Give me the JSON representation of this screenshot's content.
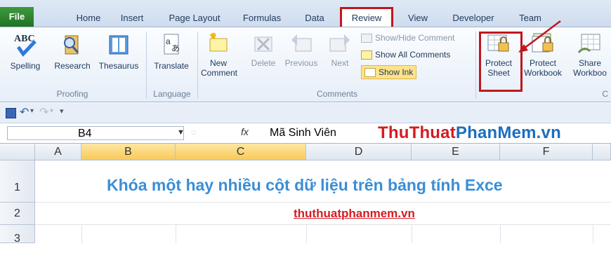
{
  "tabs": [
    "File",
    "Home",
    "Insert",
    "Page Layout",
    "Formulas",
    "Data",
    "Review",
    "View",
    "Developer",
    "Team"
  ],
  "ribbon": {
    "proofing": {
      "spelling": "Spelling",
      "research": "Research",
      "thesaurus": "Thesaurus",
      "label": "Proofing"
    },
    "language": {
      "translate": "Translate",
      "label": "Language"
    },
    "comments": {
      "new_line1": "New",
      "new_line2": "Comment",
      "delete": "Delete",
      "previous": "Previous",
      "next": "Next",
      "show_hide": "Show/Hide Comment",
      "show_all": "Show All Comments",
      "show_ink": "Show Ink",
      "label": "Comments"
    },
    "changes": {
      "protect_sheet_1": "Protect",
      "protect_sheet_2": "Sheet",
      "protect_workbook_1": "Protect",
      "protect_workbook_2": "Workbook",
      "share_workbook_1": "Share",
      "share_workbook_2": "Workboo",
      "label": "C"
    }
  },
  "formula_bar": {
    "name_box": "B4",
    "fx": "fx",
    "value": "Mã Sinh Viên"
  },
  "watermark": {
    "part1": "ThuThuat",
    "part2": "PhanMem",
    "part3": ".vn"
  },
  "columns": [
    "A",
    "B",
    "C",
    "D",
    "E",
    "F"
  ],
  "rows": [
    "1",
    "2",
    "3"
  ],
  "cells": {
    "title": "Khóa một hay nhiều cột dữ liệu trên bảng tính Exce",
    "link": "thuthuatphanmem.vn"
  },
  "colors": {
    "accent": "#c0171e",
    "title_blue": "#3a8ed6",
    "file_green": "#217321"
  }
}
